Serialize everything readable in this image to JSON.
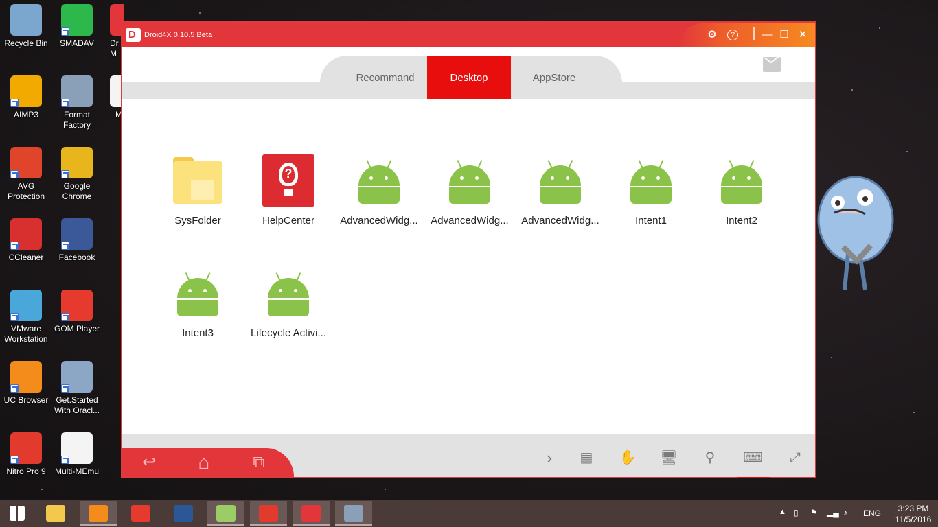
{
  "desktop_icons": [
    {
      "label": "Recycle Bin",
      "icon": "recycle-bin-icon",
      "color": "#7ba7cf"
    },
    {
      "label": "SMADAV",
      "icon": "smadav-icon",
      "color": "#2db84b"
    },
    {
      "label": "AIMP3",
      "icon": "aimp-icon",
      "color": "#f2a900"
    },
    {
      "label": "Format Factory",
      "icon": "format-factory-icon",
      "color": "#8aa0b8"
    },
    {
      "label": "AVG Protection",
      "icon": "avg-icon",
      "color": "#e0452c"
    },
    {
      "label": "Google Chrome",
      "icon": "chrome-icon",
      "color": "#e9b51d"
    },
    {
      "label": "CCleaner",
      "icon": "ccleaner-icon",
      "color": "#d8302f"
    },
    {
      "label": "Facebook",
      "icon": "facebook-icon",
      "color": "#3b5998"
    },
    {
      "label": "VMware Workstation",
      "icon": "vmware-icon",
      "color": "#4aa7d9"
    },
    {
      "label": "GOM Player",
      "icon": "gom-player-icon",
      "color": "#e53a2d"
    },
    {
      "label": "UC Browser",
      "icon": "uc-browser-icon",
      "color": "#f48c1c"
    },
    {
      "label": "Get.Started With Oracl...",
      "icon": "oracle-icon",
      "color": "#8ca6c6"
    },
    {
      "label": "Nitro Pro 9",
      "icon": "nitro-icon",
      "color": "#e23b2e"
    },
    {
      "label": "Multi-MEmu",
      "icon": "memu-icon",
      "color": "#f4f4f4"
    }
  ],
  "partial_icons": [
    "Dr",
    "M",
    "M"
  ],
  "window": {
    "title": "Droid4X 0.10.5 Beta",
    "controls": {
      "settings": "⚙",
      "help": "?",
      "minimize": "—",
      "maximize": "☐",
      "close": "✕"
    }
  },
  "tabs": [
    {
      "label": "Recommand",
      "active": false
    },
    {
      "label": "Desktop",
      "active": true
    },
    {
      "label": "AppStore",
      "active": false
    }
  ],
  "apps": [
    {
      "label": "SysFolder",
      "icon": "folder-icon"
    },
    {
      "label": "HelpCenter",
      "icon": "help-center-icon"
    },
    {
      "label": "AdvancedWidg...",
      "icon": "android-icon"
    },
    {
      "label": "AdvancedWidg...",
      "icon": "android-icon"
    },
    {
      "label": "AdvancedWidg...",
      "icon": "android-icon"
    },
    {
      "label": "Intent1",
      "icon": "android-icon"
    },
    {
      "label": "Intent2",
      "icon": "android-icon"
    },
    {
      "label": "Intent3",
      "icon": "android-icon"
    },
    {
      "label": "Lifecycle Activi...",
      "icon": "android-icon"
    }
  ],
  "page_indicator": "1",
  "bottom_nav": {
    "back": "↩",
    "home": "⌂",
    "recents": "⧉",
    "right_tools": [
      "›",
      "▤",
      "✋",
      "🖥",
      "⚲",
      "⌨",
      "⤢"
    ]
  },
  "taskbar": {
    "apps": [
      "start-icon",
      "file-explorer-icon",
      "uc-browser-icon",
      "gom-player-icon",
      "word-icon",
      "android-studio-icon",
      "nitro-icon",
      "droid4x-icon",
      "paint-icon"
    ],
    "tray": {
      "lang": "ENG",
      "time": "3:23 PM",
      "date": "11/5/2016"
    }
  }
}
